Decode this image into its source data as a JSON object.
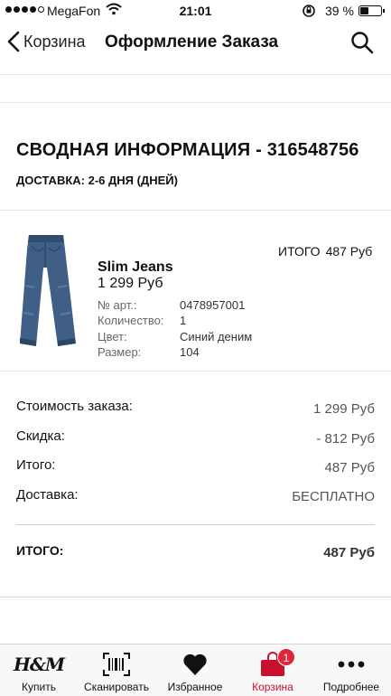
{
  "status_bar": {
    "carrier": "MegaFon",
    "time": "21:01",
    "battery_percent": "39 %",
    "battery_level": 0.39,
    "signal_bars_filled": 4,
    "signal_bars_total": 5
  },
  "nav": {
    "back_label": "Корзина",
    "title": "Оформление Заказа",
    "icons": {
      "back": "chevron-left-icon",
      "search": "search-icon"
    }
  },
  "summary": {
    "title": "СВОДНАЯ ИНФОРМАЦИЯ - 316548756",
    "delivery": "ДОСТАВКА: 2-6 ДНЯ (ДНЕЙ)"
  },
  "product": {
    "total_label": "ИТОГО",
    "total_value": "487 Руб",
    "name": "Slim Jeans",
    "price": "1 299 Руб",
    "attributes": [
      {
        "label": "№ арт.:",
        "value": "0478957001"
      },
      {
        "label": "Количество:",
        "value": "1"
      },
      {
        "label": "Цвет:",
        "value": "Синий деним"
      },
      {
        "label": "Размер:",
        "value": "104"
      }
    ]
  },
  "totals": {
    "rows": [
      {
        "label": "Стоимость заказа:",
        "value": "1 299 Руб"
      },
      {
        "label": "Скидка:",
        "value": "- 812 Руб"
      },
      {
        "label": "Итого:",
        "value": "487 Руб"
      },
      {
        "label": "Доставка:",
        "value": "БЕСПЛАТНО"
      }
    ],
    "grand_label": "ИТОГО:",
    "grand_value": "487 Руб"
  },
  "tab_bar": {
    "tabs": [
      {
        "label": "Купить",
        "icon": "hm-logo-icon",
        "logo_text": "H&M"
      },
      {
        "label": "Сканировать",
        "icon": "barcode-scan-icon"
      },
      {
        "label": "Избранное",
        "icon": "heart-icon"
      },
      {
        "label": "Корзина",
        "icon": "shopping-bag-icon",
        "badge": "1"
      },
      {
        "label": "Подробнее",
        "icon": "more-dots-icon"
      }
    ],
    "active_index": 3
  },
  "colors": {
    "accent": "#c8102e",
    "badge": "#e0263a",
    "text": "#111111",
    "muted": "#666666"
  }
}
